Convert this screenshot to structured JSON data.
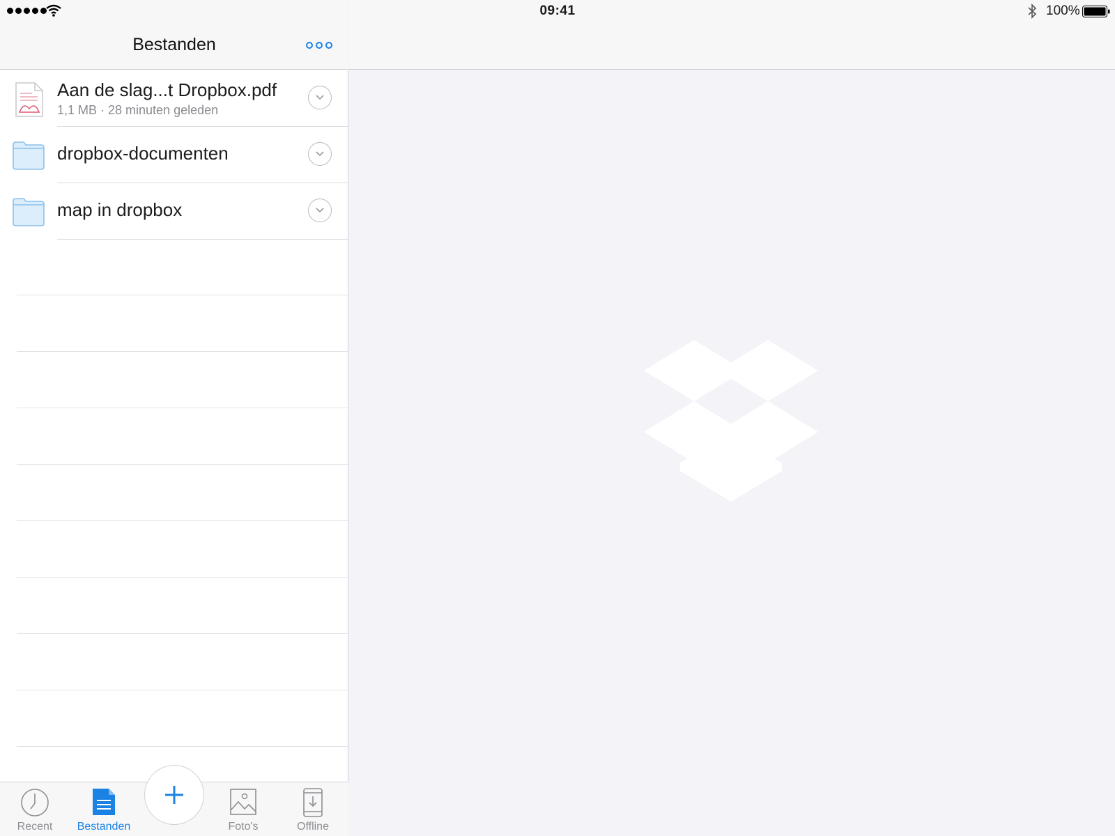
{
  "status_bar": {
    "time": "09:41",
    "battery": "100%",
    "icons": [
      "signal-dots",
      "wifi-icon",
      "bluetooth-icon",
      "battery-icon"
    ]
  },
  "nav": {
    "title": "Bestanden",
    "more_icon": "more-icon"
  },
  "files": [
    {
      "type": "file",
      "icon": "pdf-file-icon",
      "name": "Aan de slag...t Dropbox.pdf",
      "meta": "1,1 MB · 28 minuten geleden"
    },
    {
      "type": "folder",
      "icon": "folder-icon",
      "name": "dropbox-documenten"
    },
    {
      "type": "folder",
      "icon": "folder-icon",
      "name": "map in dropbox"
    }
  ],
  "tabs": [
    {
      "label": "Recent",
      "icon": "clock-icon",
      "active": false
    },
    {
      "label": "Bestanden",
      "icon": "document-icon",
      "active": true
    },
    {
      "label": "Foto's",
      "icon": "photo-icon",
      "active": false
    },
    {
      "label": "Offline",
      "icon": "offline-device-icon",
      "active": false
    }
  ],
  "add_button_icon": "plus-icon",
  "colors": {
    "accent": "#1a82e2",
    "folder": "#8cc0ec",
    "background": "#f4f4f8"
  },
  "placeholder_logo": "dropbox-logo"
}
